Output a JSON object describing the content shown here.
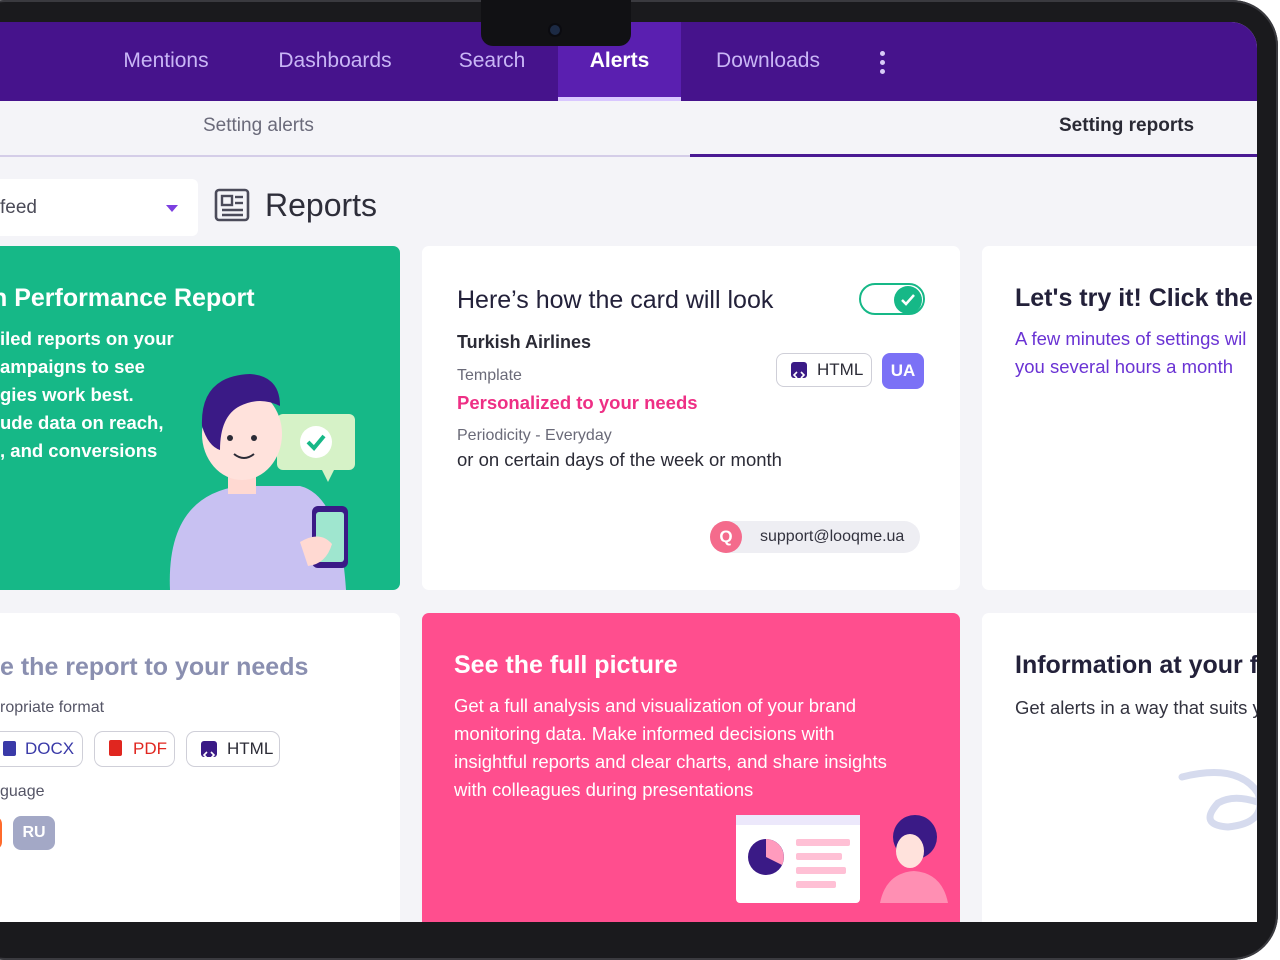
{
  "nav": {
    "items": [
      {
        "label": "Mentions"
      },
      {
        "label": "Dashboards"
      },
      {
        "label": "Search"
      },
      {
        "label": "Alerts",
        "active": true
      },
      {
        "label": "Downloads"
      }
    ],
    "more_icon": "kebab-vertical-icon"
  },
  "subtabs": {
    "setting_alerts": "Setting alerts",
    "setting_reports": "Setting reports",
    "active": "setting_reports"
  },
  "toolbar": {
    "select_value": "feed",
    "reports_title": "Reports",
    "reports_icon": "report-icon"
  },
  "cards": {
    "performance": {
      "title": "n Performance Report",
      "lines": [
        "iled reports on your",
        "ampaigns to see",
        "gies work best.",
        "ude data on reach,",
        ", and conversions"
      ]
    },
    "preview": {
      "title": "Here’s how the card will look",
      "toggle_on": true,
      "company": "Turkish Airlines",
      "template_label": "Template",
      "template_value": "Personalized to your needs",
      "periodicity_label": "Periodicity - Everyday",
      "periodicity_desc": "or on certain days of the week or month",
      "format_chip": "HTML",
      "language_chip": "UA",
      "avatar_letter": "Q",
      "email": "support@looqme.ua"
    },
    "try_it": {
      "title": "Let's try it! Click the b",
      "lines": [
        "A few minutes of settings wil",
        "you several hours a month"
      ]
    },
    "customize": {
      "title": "e the report to your needs",
      "format_label": "ropriate format",
      "formats": [
        "DOCX",
        "PDF",
        "HTML"
      ],
      "language_label": "guage",
      "languages": [
        "RU"
      ]
    },
    "full_picture": {
      "title": "See the full picture",
      "lines": [
        "Get a full analysis and visualization of your brand",
        "monitoring data. Make informed decisions with",
        "insightful reports and clear charts, and share insights",
        "with colleagues during presentations"
      ]
    },
    "information": {
      "title": "Information at your fi",
      "line": "Get alerts in a way that suits y"
    }
  },
  "colors": {
    "nav_bg": "#46138c",
    "accent_purple": "#4a1a93",
    "green": "#16b887",
    "pink": "#ff4e8e",
    "template_pink": "#ee2f85",
    "ua_badge": "#7b71f6"
  }
}
